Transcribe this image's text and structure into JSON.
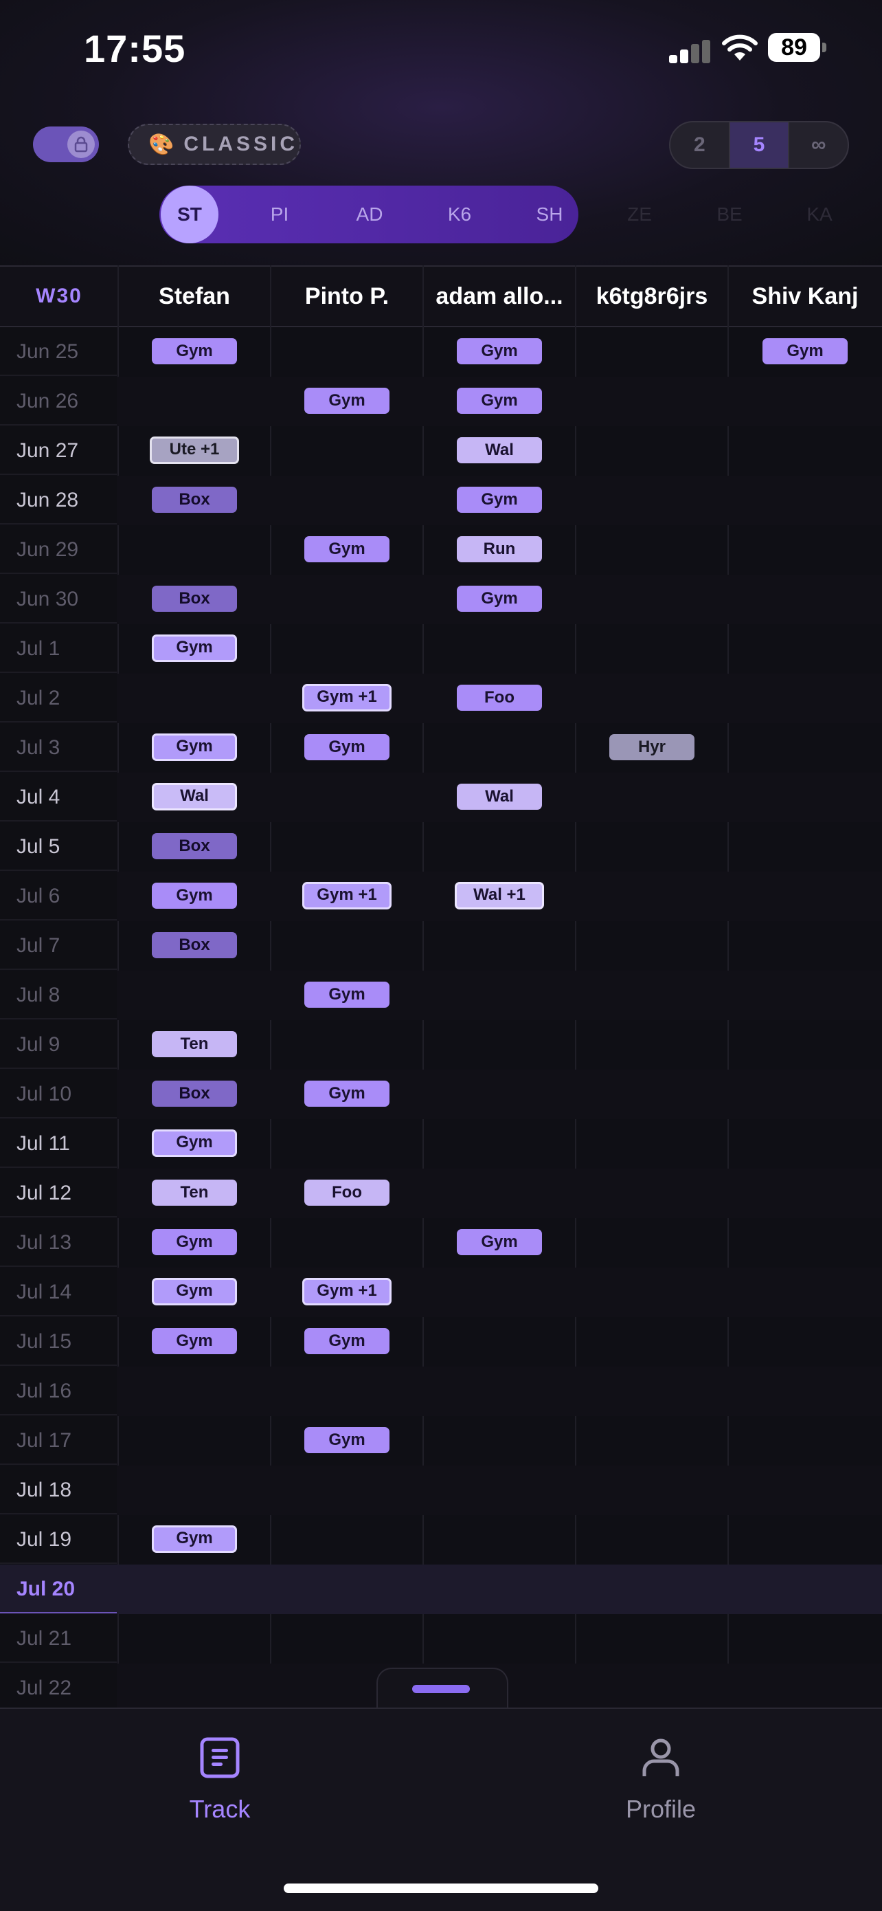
{
  "status": {
    "time": "17:55",
    "battery": "89"
  },
  "controls": {
    "theme_label": "CLASSIC",
    "segments": [
      {
        "label": "2",
        "active": false
      },
      {
        "label": "5",
        "active": true
      },
      {
        "label": "∞",
        "active": false
      }
    ]
  },
  "users": [
    {
      "label": "ST",
      "active": true,
      "faded": false
    },
    {
      "label": "PI",
      "active": false,
      "faded": false
    },
    {
      "label": "AD",
      "active": false,
      "faded": false
    },
    {
      "label": "K6",
      "active": false,
      "faded": false
    },
    {
      "label": "SH",
      "active": false,
      "faded": false
    },
    {
      "label": "ZE",
      "active": false,
      "faded": true
    },
    {
      "label": "BE",
      "active": false,
      "faded": true
    },
    {
      "label": "KA",
      "active": false,
      "faded": true
    }
  ],
  "table": {
    "week_label": "W30",
    "columns": [
      "Stefan",
      "Pinto P.",
      "adam allo...",
      "k6tg8r6jrs",
      "Shiv Kanj"
    ],
    "rows": [
      {
        "date": "Jun 25",
        "dim": true,
        "cells": [
          {
            "t": "Gym",
            "s": "n"
          },
          null,
          {
            "t": "Gym",
            "s": "n"
          },
          null,
          {
            "t": "Gym",
            "s": "n"
          }
        ]
      },
      {
        "date": "Jun 26",
        "dim": true,
        "cells": [
          null,
          {
            "t": "Gym",
            "s": "n"
          },
          {
            "t": "Gym",
            "s": "n"
          },
          null,
          null
        ]
      },
      {
        "date": "Jun 27",
        "dim": false,
        "cells": [
          {
            "t": "Ute +1",
            "s": "gb"
          },
          null,
          {
            "t": "Wal",
            "s": "l"
          },
          null,
          null
        ]
      },
      {
        "date": "Jun 28",
        "dim": false,
        "cells": [
          {
            "t": "Box",
            "s": "d"
          },
          null,
          {
            "t": "Gym",
            "s": "n"
          },
          null,
          null
        ]
      },
      {
        "date": "Jun 29",
        "dim": true,
        "cells": [
          null,
          {
            "t": "Gym",
            "s": "n"
          },
          {
            "t": "Run",
            "s": "l"
          },
          null,
          null
        ]
      },
      {
        "date": "Jun 30",
        "dim": true,
        "cells": [
          {
            "t": "Box",
            "s": "d"
          },
          null,
          {
            "t": "Gym",
            "s": "n"
          },
          null,
          null
        ]
      },
      {
        "date": "Jul 1",
        "dim": true,
        "cells": [
          {
            "t": "Gym",
            "s": "b"
          },
          null,
          null,
          null,
          null
        ]
      },
      {
        "date": "Jul 2",
        "dim": true,
        "cells": [
          null,
          {
            "t": "Gym +1",
            "s": "b"
          },
          {
            "t": "Foo",
            "s": "n"
          },
          null,
          null
        ]
      },
      {
        "date": "Jul 3",
        "dim": true,
        "cells": [
          {
            "t": "Gym",
            "s": "b"
          },
          {
            "t": "Gym",
            "s": "n"
          },
          null,
          {
            "t": "Hyr",
            "s": "g"
          },
          null
        ]
      },
      {
        "date": "Jul 4",
        "dim": false,
        "cells": [
          {
            "t": "Wal",
            "s": "lb"
          },
          null,
          {
            "t": "Wal",
            "s": "l"
          },
          null,
          null
        ]
      },
      {
        "date": "Jul 5",
        "dim": false,
        "cells": [
          {
            "t": "Box",
            "s": "d"
          },
          null,
          null,
          null,
          null
        ]
      },
      {
        "date": "Jul 6",
        "dim": true,
        "cells": [
          {
            "t": "Gym",
            "s": "n"
          },
          {
            "t": "Gym +1",
            "s": "b"
          },
          {
            "t": "Wal +1",
            "s": "lb"
          },
          null,
          null
        ]
      },
      {
        "date": "Jul 7",
        "dim": true,
        "cells": [
          {
            "t": "Box",
            "s": "d"
          },
          null,
          null,
          null,
          null
        ]
      },
      {
        "date": "Jul 8",
        "dim": true,
        "cells": [
          null,
          {
            "t": "Gym",
            "s": "n"
          },
          null,
          null,
          null
        ]
      },
      {
        "date": "Jul 9",
        "dim": true,
        "cells": [
          {
            "t": "Ten",
            "s": "l"
          },
          null,
          null,
          null,
          null
        ]
      },
      {
        "date": "Jul 10",
        "dim": true,
        "cells": [
          {
            "t": "Box",
            "s": "d"
          },
          {
            "t": "Gym",
            "s": "n"
          },
          null,
          null,
          null
        ]
      },
      {
        "date": "Jul 11",
        "dim": false,
        "cells": [
          {
            "t": "Gym",
            "s": "b"
          },
          null,
          null,
          null,
          null
        ]
      },
      {
        "date": "Jul 12",
        "dim": false,
        "cells": [
          {
            "t": "Ten",
            "s": "l"
          },
          {
            "t": "Foo",
            "s": "l"
          },
          null,
          null,
          null
        ]
      },
      {
        "date": "Jul 13",
        "dim": true,
        "cells": [
          {
            "t": "Gym",
            "s": "n"
          },
          null,
          {
            "t": "Gym",
            "s": "n"
          },
          null,
          null
        ]
      },
      {
        "date": "Jul 14",
        "dim": true,
        "cells": [
          {
            "t": "Gym",
            "s": "b"
          },
          {
            "t": "Gym +1",
            "s": "b"
          },
          null,
          null,
          null
        ]
      },
      {
        "date": "Jul 15",
        "dim": true,
        "cells": [
          {
            "t": "Gym",
            "s": "n"
          },
          {
            "t": "Gym",
            "s": "n"
          },
          null,
          null,
          null
        ]
      },
      {
        "date": "Jul 16",
        "dim": true,
        "cells": [
          null,
          null,
          null,
          null,
          null
        ]
      },
      {
        "date": "Jul 17",
        "dim": true,
        "cells": [
          null,
          {
            "t": "Gym",
            "s": "n"
          },
          null,
          null,
          null
        ]
      },
      {
        "date": "Jul 18",
        "dim": false,
        "cells": [
          null,
          null,
          null,
          null,
          null
        ]
      },
      {
        "date": "Jul 19",
        "dim": false,
        "cells": [
          {
            "t": "Gym",
            "s": "b"
          },
          null,
          null,
          null,
          null
        ]
      },
      {
        "date": "Jul 20",
        "dim": false,
        "today": true,
        "cells": [
          null,
          null,
          null,
          null,
          null
        ]
      },
      {
        "date": "Jul 21",
        "dim": true,
        "cells": [
          null,
          null,
          null,
          null,
          null
        ]
      },
      {
        "date": "Jul 22",
        "dim": true,
        "cells": [
          null,
          null,
          null,
          null,
          null
        ]
      }
    ]
  },
  "tabs": [
    {
      "label": "Track",
      "active": true,
      "icon": "track-icon"
    },
    {
      "label": "Profile",
      "active": false,
      "icon": "profile-icon"
    }
  ],
  "colors": {
    "accent": "#a585ff",
    "chip_normal": "#a98cf8",
    "chip_light": "#c6b6f5",
    "chip_dark": "#7f68c7",
    "chip_gray": "#9a96b6"
  }
}
